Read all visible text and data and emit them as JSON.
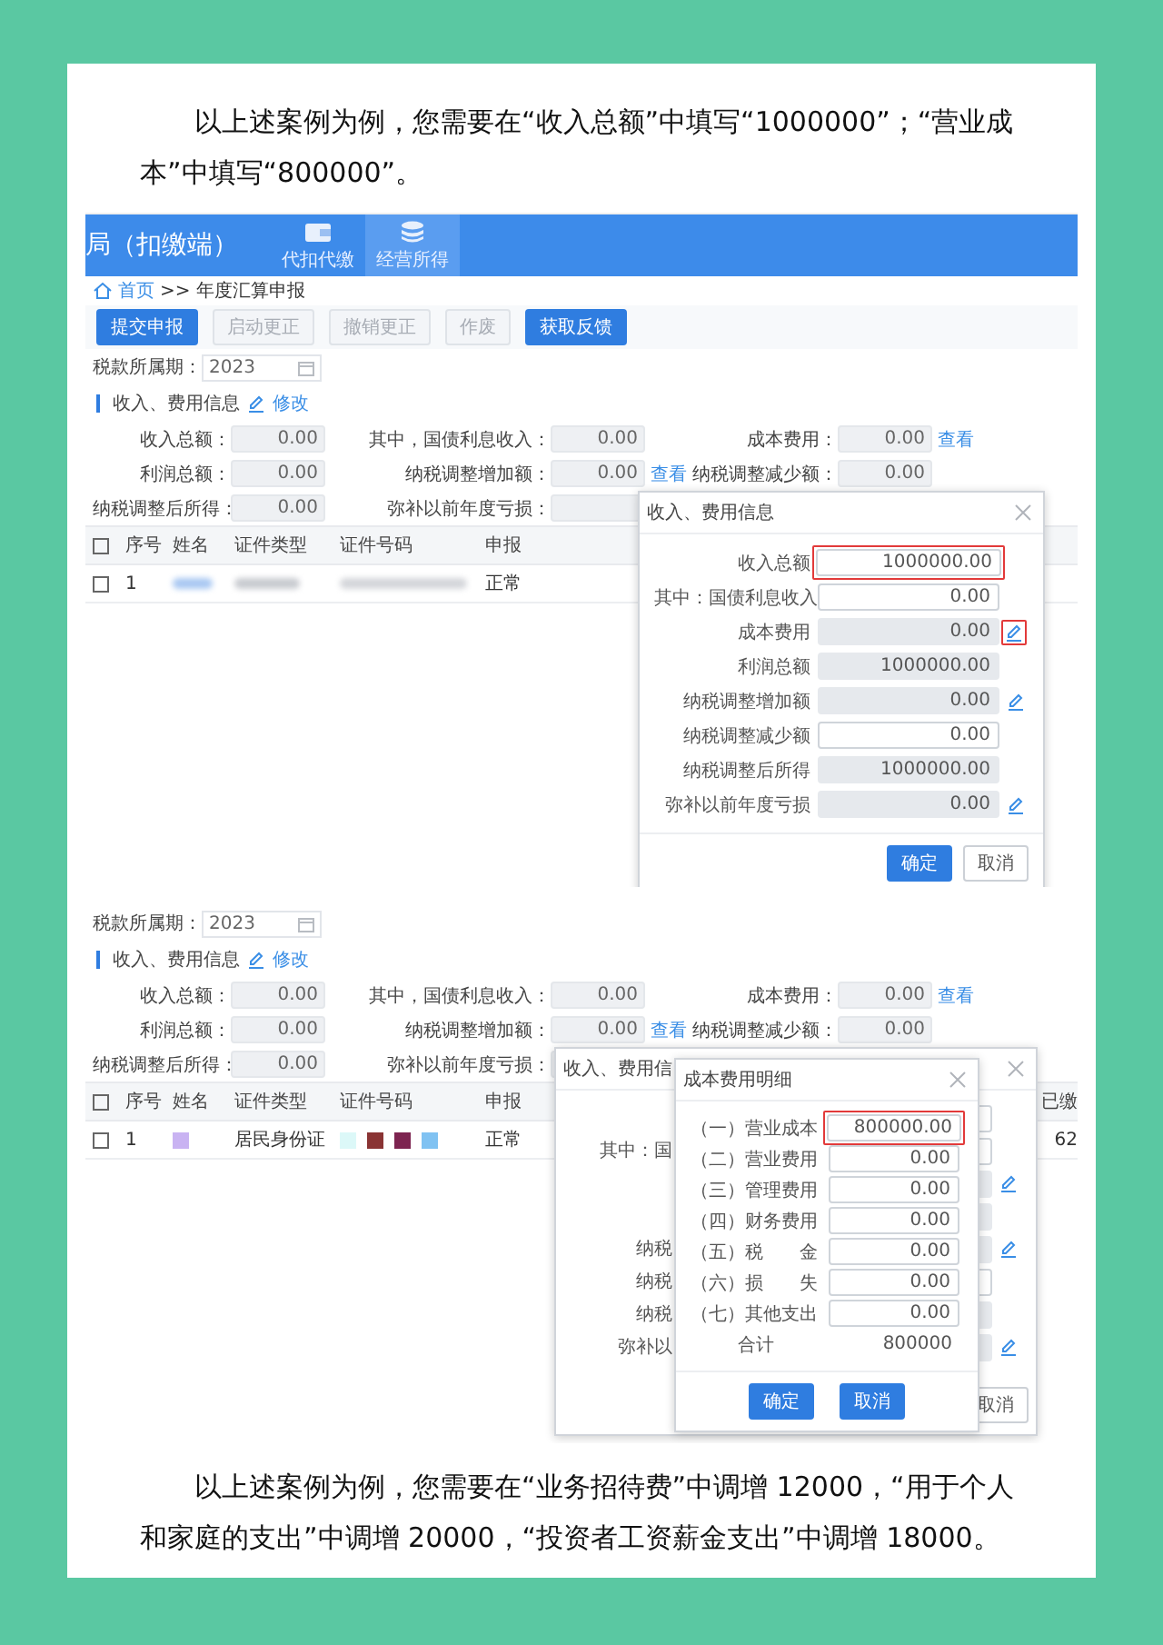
{
  "intro_text": "以上述案例为例，您需要在“收入总额”中填写“1000000”；“营业成本”中填写“800000”。",
  "screenshots": [
    {
      "header": {
        "title": "局（扣缴端）",
        "nav": [
          {
            "label": "代扣代缴",
            "selected": false
          },
          {
            "label": "经营所得",
            "selected": true
          }
        ]
      },
      "breadcrumb": {
        "home": "首页",
        "separator": ">>",
        "current": "年度汇算申报"
      },
      "toolbar": [
        {
          "label": "提交申报",
          "disabled": false
        },
        {
          "label": "启动更正",
          "disabled": true
        },
        {
          "label": "撤销更正",
          "disabled": true
        },
        {
          "label": "作废",
          "disabled": true
        },
        {
          "label": "获取反馈",
          "disabled": false
        }
      ],
      "period": {
        "label": "税款所属期：",
        "value": "2023"
      },
      "section": {
        "title": "收入、费用信息",
        "action": "修改"
      },
      "form": [
        {
          "label": "收入总额：",
          "value": "0.00"
        },
        {
          "label": "其中，国债利息收入：",
          "value": "0.00"
        },
        {
          "label": "成本费用：",
          "value": "0.00",
          "link": "查看"
        },
        {
          "label": "利润总额：",
          "value": "0.00"
        },
        {
          "label": "纳税调整增加额：",
          "value": "0.00",
          "link": "查看"
        },
        {
          "label": "纳税调整减少额：",
          "value": "0.00"
        },
        {
          "label": "纳税调整后所得：",
          "value": "0.00"
        },
        {
          "label": "弥补以前年度亏损："
        }
      ],
      "table": {
        "header_checkbox": {
          "checked": false
        },
        "columns": [
          "序号",
          "姓名",
          "证件类型",
          "证件号码",
          "申报"
        ],
        "rows": [
          {
            "checked": false,
            "cells": [
              {
                "kind": "text",
                "text": "1"
              },
              {
                "kind": "blur"
              },
              {
                "kind": "blur"
              },
              {
                "kind": "blur"
              },
              {
                "kind": "text",
                "text": "正常"
              }
            ]
          }
        ]
      },
      "dialogs": [
        {
          "title": "收入、费用信息",
          "rows": [
            {
              "label": "收入总额",
              "value": "1000000.00",
              "editable": true,
              "edit_icon": false,
              "highlighted": true
            },
            {
              "label": "其中：国债利息收入",
              "value": "0.00",
              "editable": true,
              "edit_icon": false,
              "highlighted": false
            },
            {
              "label": "成本费用",
              "value": "0.00",
              "editable": false,
              "edit_icon": true,
              "highlighted": true
            },
            {
              "label": "利润总额",
              "value": "1000000.00",
              "editable": false,
              "edit_icon": false,
              "highlighted": false
            },
            {
              "label": "纳税调整增加额",
              "value": "0.00",
              "editable": false,
              "edit_icon": true,
              "highlighted": false
            },
            {
              "label": "纳税调整减少额",
              "value": "0.00",
              "editable": true,
              "edit_icon": false,
              "highlighted": false
            },
            {
              "label": "纳税调整后所得",
              "value": "1000000.00",
              "editable": false,
              "edit_icon": false,
              "highlighted": false
            },
            {
              "label": "弥补以前年度亏损",
              "value": "0.00",
              "editable": false,
              "edit_icon": true,
              "highlighted": false
            }
          ],
          "buttons": [
            {
              "label": "确定",
              "primary": true
            },
            {
              "label": "取消",
              "primary": false
            }
          ]
        }
      ]
    },
    {
      "period": {
        "label": "税款所属期：",
        "value": "2023"
      },
      "section": {
        "title": "收入、费用信息",
        "action": "修改"
      },
      "form": [
        {
          "label": "收入总额：",
          "value": "0.00"
        },
        {
          "label": "其中，国债利息收入：",
          "value": "0.00"
        },
        {
          "label": "成本费用：",
          "value": "0.00",
          "link": "查看"
        },
        {
          "label": "利润总额：",
          "value": "0.00"
        },
        {
          "label": "纳税调整增加额：",
          "value": "0.00",
          "link": "查看"
        },
        {
          "label": "纳税调整减少额：",
          "value": "0.00"
        },
        {
          "label": "纳税调整后所得：",
          "value": "0.00"
        },
        {
          "label": "弥补以前年度亏损："
        }
      ],
      "table": {
        "header_checkbox": {
          "checked": false
        },
        "columns": [
          "序号",
          "姓名",
          "证件类型",
          "证件号码",
          "申报",
          "已缴"
        ],
        "rows": [
          {
            "checked": false,
            "cells": [
              {
                "kind": "text",
                "text": "1"
              },
              {
                "kind": "masks",
                "masks": [
                  {
                    "color": "#c9b3f2"
                  }
                ]
              },
              {
                "kind": "text",
                "text": "居民身份证"
              },
              {
                "kind": "masks",
                "masks": [
                  {
                    "color": "#dcf8f8"
                  },
                  {
                    "color": "#8a3434"
                  },
                  {
                    "color": "#7d2450"
                  },
                  {
                    "color": "#80c2f2"
                  }
                ]
              },
              {
                "kind": "text",
                "text": "正常"
              },
              {
                "kind": "text",
                "text": "62"
              }
            ]
          }
        ]
      },
      "dialogs": [
        {
          "title": "收入、费用信",
          "rows": [
            {
              "editable": true,
              "edit_icon": false
            },
            {
              "label": "其中：国",
              "editable": true,
              "edit_icon": false
            },
            {
              "editable": false,
              "edit_icon": true
            },
            {
              "editable": false,
              "edit_icon": false
            },
            {
              "label": "纳税",
              "editable": false,
              "edit_icon": true
            },
            {
              "label": "纳税",
              "editable": true,
              "edit_icon": false
            },
            {
              "label": "纳税",
              "editable": false,
              "edit_icon": false
            },
            {
              "label": "弥补以",
              "editable": false,
              "edit_icon": true
            }
          ],
          "buttons": [
            {
              "label": "取消",
              "primary": false
            }
          ]
        },
        {
          "title": "成本费用明细",
          "rows": [
            {
              "kind": "field",
              "label": "（一）营业成本",
              "value": "800000.00",
              "editable": true,
              "highlighted": true
            },
            {
              "kind": "field",
              "label": "（二）营业费用",
              "value": "0.00",
              "editable": true,
              "highlighted": false
            },
            {
              "kind": "field",
              "label": "（三）管理费用",
              "value": "0.00",
              "editable": true,
              "highlighted": false
            },
            {
              "kind": "field",
              "label": "（四）财务费用",
              "value": "0.00",
              "editable": true,
              "highlighted": false
            },
            {
              "kind": "field",
              "label": "（五）税　　金",
              "value": "0.00",
              "editable": true,
              "highlighted": false
            },
            {
              "kind": "field",
              "label": "（六）损　　失",
              "value": "0.00",
              "editable": true,
              "highlighted": false
            },
            {
              "kind": "field",
              "label": "（七）其他支出",
              "value": "0.00",
              "editable": true,
              "highlighted": false
            },
            {
              "kind": "total",
              "label": "合计",
              "value": "800000"
            }
          ],
          "buttons": [
            {
              "label": "确定",
              "primary": true
            },
            {
              "label": "取消",
              "primary": true
            }
          ]
        }
      ]
    }
  ],
  "closing_text": "以上述案例为例，您需要在“业务招待费”中调增 12000，“用于个人和家庭的支出”中调增 20000，“投资者工资薪金支出”中调增 18000。"
}
